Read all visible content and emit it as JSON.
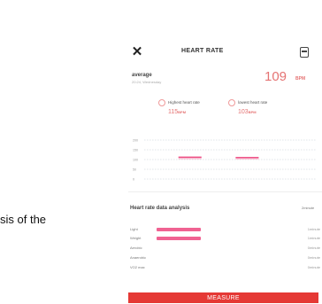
{
  "background_text": "sis of the",
  "header": {
    "title": "HEART RATE",
    "close_icon": "close-icon",
    "share_icon": "share-icon"
  },
  "average": {
    "label": "average",
    "sub": "20:24, Wednesday",
    "value": "109",
    "unit": "BPM"
  },
  "stats": [
    {
      "label": "Highest heart rate",
      "value": "115",
      "unit": "BPM"
    },
    {
      "label": "lowest heart rate",
      "value": "103",
      "unit": "BPM"
    }
  ],
  "chart_data": {
    "type": "bar",
    "y_ticks": [
      "200",
      "150",
      "100",
      "50",
      "0"
    ],
    "ylim": [
      0,
      200
    ],
    "bars": [
      {
        "from": 102,
        "to": 115
      },
      {
        "from": 101,
        "to": 113
      }
    ],
    "bar_color": "#f8bbd0",
    "cap_color": "#ec407a"
  },
  "zones": {
    "title": "Heart rate data analysis",
    "unit": "2minute",
    "rows": [
      {
        "label": "Light",
        "value": "1minute",
        "fraction": 0.62
      },
      {
        "label": "Weight",
        "value": "1minute",
        "fraction": 0.62
      },
      {
        "label": "Aerobic",
        "value": "0minute",
        "fraction": 0
      },
      {
        "label": "Anaerobic",
        "value": "0minute",
        "fraction": 0
      },
      {
        "label": "VO2 max",
        "value": "0minute",
        "fraction": 0
      }
    ]
  },
  "button": {
    "label": "MEASURE"
  },
  "colors": {
    "accent": "#e53935",
    "value": "#e57373",
    "bar": "#f06292"
  }
}
